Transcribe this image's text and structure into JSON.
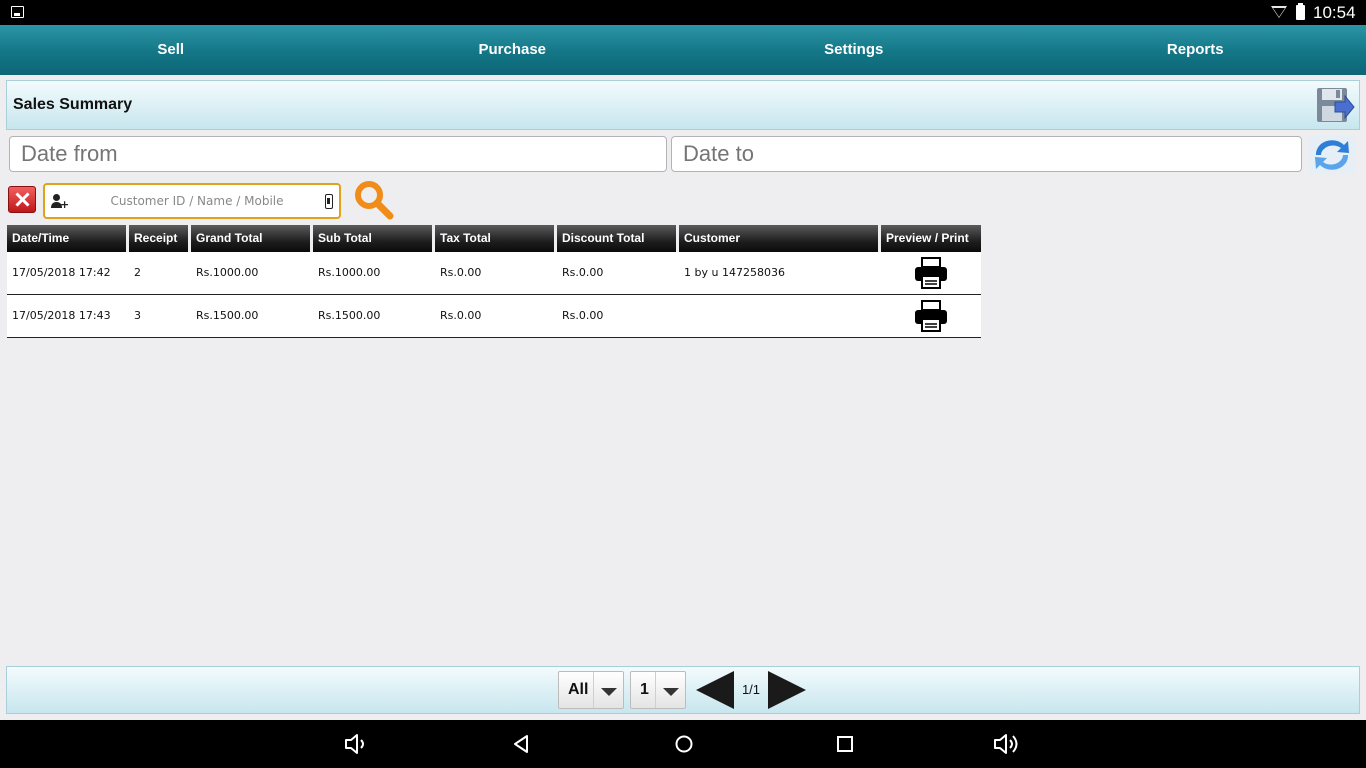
{
  "status_bar": {
    "time": "10:54"
  },
  "tabs": [
    {
      "label": "Sell"
    },
    {
      "label": "Purchase"
    },
    {
      "label": "Settings"
    },
    {
      "label": "Reports"
    }
  ],
  "header": {
    "title": "Sales Summary"
  },
  "filters": {
    "date_from_placeholder": "Date from",
    "date_to_placeholder": "Date to",
    "customer_placeholder": "Customer ID / Name / Mobile"
  },
  "table": {
    "columns": [
      "Date/Time",
      "Receipt",
      "Grand Total",
      "Sub Total",
      "Tax Total",
      "Discount Total",
      "Customer",
      "Preview / Print"
    ],
    "rows": [
      {
        "datetime": "17/05/2018 17:42",
        "receipt": "2",
        "grand_total": "Rs.1000.00",
        "sub_total": "Rs.1000.00",
        "tax_total": "Rs.0.00",
        "discount_total": "Rs.0.00",
        "customer": "1 by u 147258036"
      },
      {
        "datetime": "17/05/2018 17:43",
        "receipt": "3",
        "grand_total": "Rs.1500.00",
        "sub_total": "Rs.1500.00",
        "tax_total": "Rs.0.00",
        "discount_total": "Rs.0.00",
        "customer": ""
      }
    ]
  },
  "pagination": {
    "filter_value": "All",
    "page_value": "1",
    "page_count": "1/1"
  },
  "icons": {
    "save": "save-export-icon",
    "refresh": "refresh-icon",
    "clear": "close-icon",
    "search": "search-icon",
    "print": "printer-icon"
  },
  "colors": {
    "tab_bar": "#137686",
    "header_bg": "#c7e6ee",
    "search_accent": "#f08c1a",
    "clear_red": "#c0171a"
  }
}
